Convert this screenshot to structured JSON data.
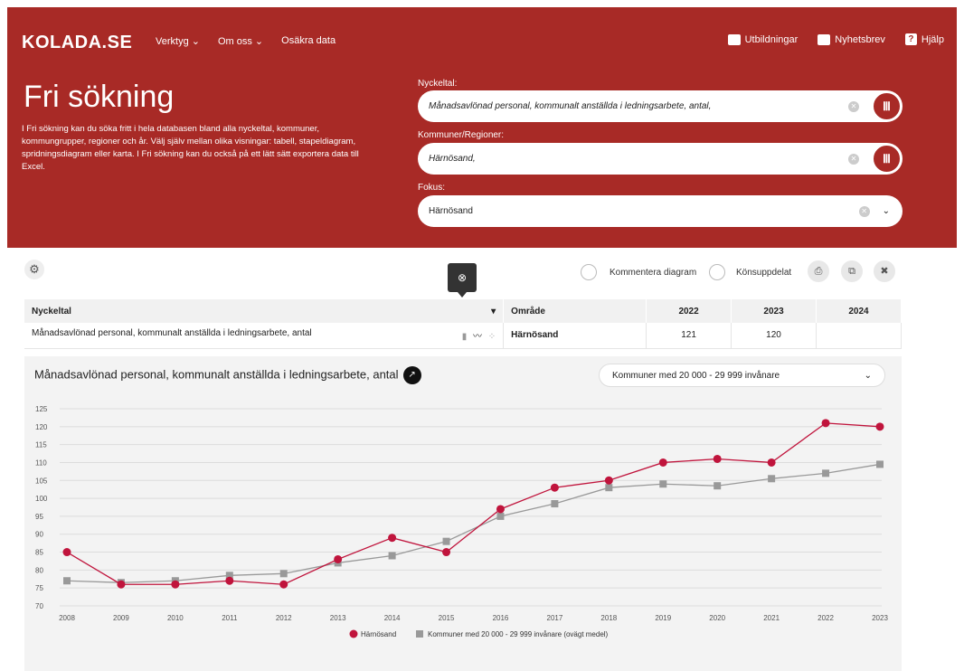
{
  "header": {
    "logo": "KOLADA.SE",
    "nav": [
      "Verktyg ⌄",
      "Om oss ⌄",
      "Osäkra data"
    ],
    "right_nav": {
      "courses": "Utbildningar",
      "newsletter": "Nyhetsbrev",
      "help": "Hjälp"
    },
    "title": "Fri sökning",
    "description": "I Fri sökning kan du söka fritt i hela databasen bland alla nyckeltal, kommuner, kommungrupper, regioner och år. Välj själv mellan olika visningar: tabell, stapeldiagram, spridningsdiagram eller karta. I Fri sökning kan du också på ett lätt sätt exportera data till Excel."
  },
  "search": {
    "kpi_label": "Nyckeltal:",
    "kpi_value": "Månadsavlönad personal, kommunalt anställda i ledningsarbete, antal,",
    "region_label": "Kommuner/Regioner:",
    "region_value": "Härnösand,",
    "focus_label": "Fokus:",
    "focus_value": "Härnösand"
  },
  "toolbar": {
    "comment": "Kommentera diagram",
    "gender": "Könsuppdelat"
  },
  "table": {
    "headers": [
      "Nyckeltal",
      "Område",
      "2022",
      "2023",
      "2024"
    ],
    "row": {
      "kpi": "Månadsavlönad personal, kommunalt anställda i ledningsarbete, antal",
      "area": "Härnösand",
      "v2022": "121",
      "v2023": "120",
      "v2024": ""
    }
  },
  "chart_panel": {
    "title": "Månadsavlönad personal, kommunalt anställda i ledningsarbete, antal",
    "compare_select": "Kommuner med 20 000 - 29 999 invånare"
  },
  "colors": {
    "brand": "#a82a26",
    "series1": "#c0143c",
    "series2": "#999999"
  },
  "chart_data": {
    "type": "line",
    "x": [
      "2008",
      "2009",
      "2010",
      "2011",
      "2012",
      "2013",
      "2014",
      "2015",
      "2016",
      "2017",
      "2018",
      "2019",
      "2020",
      "2021",
      "2022",
      "2023"
    ],
    "ylim": [
      70,
      125
    ],
    "yticks": [
      70,
      75,
      80,
      85,
      90,
      95,
      100,
      105,
      110,
      115,
      120,
      125
    ],
    "grid": true,
    "legend_position": "bottom",
    "series": [
      {
        "name": "Härnösand",
        "marker": "circle",
        "values": [
          85,
          76,
          76,
          77,
          76,
          83,
          89,
          85,
          97,
          103,
          105,
          110,
          111,
          110,
          121,
          120
        ]
      },
      {
        "name": "Kommuner med 20 000 - 29 999 invånare (ovägt medel)",
        "marker": "square",
        "values": [
          77,
          76.5,
          77,
          78.5,
          79,
          82,
          84,
          88,
          95,
          98.5,
          103,
          104,
          103.5,
          105.5,
          107,
          109.5
        ]
      }
    ]
  }
}
